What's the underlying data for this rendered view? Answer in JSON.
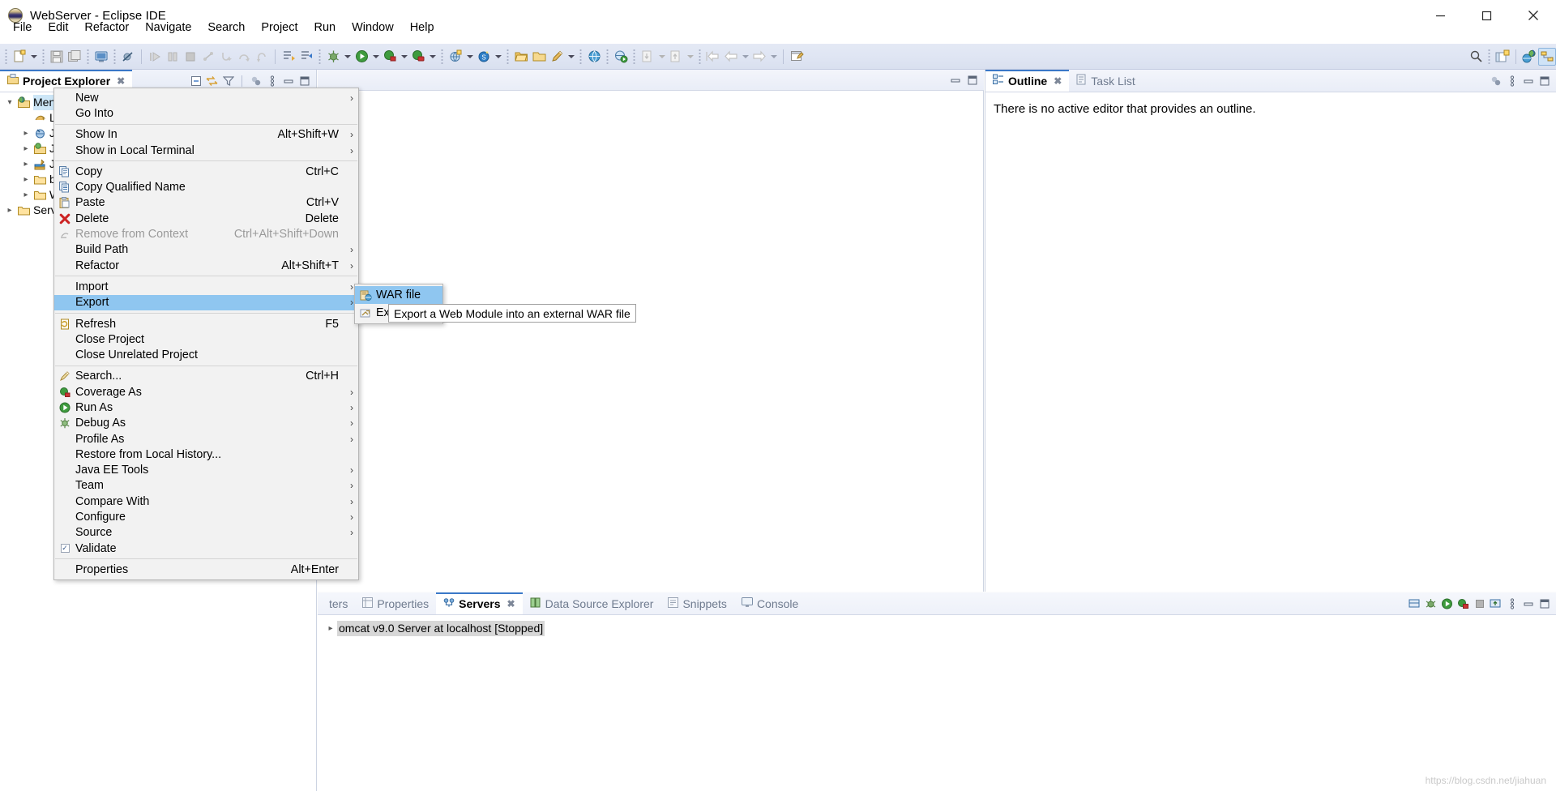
{
  "window": {
    "title": "WebServer - Eclipse IDE",
    "app_icon": "eclipse-icon",
    "minimize_label": "Minimize",
    "maximize_label": "Maximize",
    "close_label": "Close"
  },
  "menubar": {
    "items": [
      {
        "label": "File"
      },
      {
        "label": "Edit"
      },
      {
        "label": "Refactor"
      },
      {
        "label": "Navigate"
      },
      {
        "label": "Search"
      },
      {
        "label": "Project"
      },
      {
        "label": "Run"
      },
      {
        "label": "Window"
      },
      {
        "label": "Help"
      }
    ]
  },
  "toolbar": {
    "groups": [
      {
        "items": [
          {
            "icon": "new-wizard-icon",
            "dropdown": true,
            "enabled": true
          },
          {
            "icon": "save-icon",
            "dropdown": false,
            "enabled": false
          },
          {
            "icon": "save-all-icon",
            "dropdown": false,
            "enabled": false
          }
        ]
      },
      {
        "items": [
          {
            "icon": "new-console-icon",
            "dropdown": false,
            "enabled": true
          }
        ]
      },
      {
        "items": [
          {
            "icon": "skip-breakpoints-icon",
            "dropdown": false,
            "enabled": true
          }
        ]
      },
      {
        "items": [
          {
            "icon": "resume-icon",
            "dropdown": false,
            "enabled": false
          },
          {
            "icon": "suspend-icon",
            "dropdown": false,
            "enabled": false
          },
          {
            "icon": "terminate-icon",
            "dropdown": false,
            "enabled": false
          },
          {
            "icon": "disconnect-icon",
            "dropdown": false,
            "enabled": false
          },
          {
            "icon": "step-into-icon",
            "dropdown": false,
            "enabled": false
          },
          {
            "icon": "step-over-icon",
            "dropdown": false,
            "enabled": false
          },
          {
            "icon": "step-return-icon",
            "dropdown": false,
            "enabled": false
          }
        ]
      },
      {
        "items": [
          {
            "icon": "next-annotation-icon",
            "dropdown": false,
            "enabled": true
          },
          {
            "icon": "previous-annotation-icon",
            "dropdown": false,
            "enabled": true
          }
        ]
      },
      {
        "items": [
          {
            "icon": "debug-icon",
            "dropdown": true,
            "enabled": true
          },
          {
            "icon": "run-icon",
            "dropdown": true,
            "enabled": true
          },
          {
            "icon": "coverage-icon",
            "dropdown": true,
            "enabled": true
          },
          {
            "icon": "profile-icon",
            "dropdown": true,
            "enabled": true
          }
        ]
      },
      {
        "items": [
          {
            "icon": "new-server-icon",
            "dropdown": true,
            "enabled": true
          },
          {
            "icon": "new-dynamic-web-project-icon",
            "dropdown": true,
            "enabled": true
          }
        ]
      },
      {
        "items": [
          {
            "icon": "open-type-icon",
            "dropdown": false,
            "enabled": true
          },
          {
            "icon": "open-task-icon",
            "dropdown": false,
            "enabled": true
          },
          {
            "icon": "new-java-class-icon",
            "dropdown": true,
            "enabled": true
          }
        ]
      },
      {
        "items": [
          {
            "icon": "open-web-browser-icon",
            "dropdown": false,
            "enabled": true
          }
        ]
      },
      {
        "items": [
          {
            "icon": "run-on-server-icon",
            "dropdown": false,
            "enabled": true
          }
        ]
      },
      {
        "items": [
          {
            "icon": "import-icon",
            "dropdown": true,
            "enabled": false
          },
          {
            "icon": "export-icon",
            "dropdown": true,
            "enabled": false
          }
        ]
      },
      {
        "items": [
          {
            "icon": "back-to-icon",
            "dropdown": false,
            "enabled": false
          },
          {
            "icon": "previous-edit-icon",
            "dropdown": true,
            "enabled": false
          },
          {
            "icon": "next-edit-icon",
            "dropdown": true,
            "enabled": false
          }
        ]
      },
      {
        "items": [
          {
            "icon": "new-editor-icon",
            "dropdown": false,
            "enabled": true
          }
        ]
      }
    ],
    "right_items": [
      {
        "icon": "search-icon"
      },
      {
        "icon": "open-perspective-icon"
      },
      {
        "icon": "java-ee-perspective-icon"
      },
      {
        "icon": "java-perspective-icon"
      }
    ]
  },
  "explorer": {
    "tab_label": "Project Explorer",
    "tab_icon": "project-explorer-icon",
    "close_glyph": "✖",
    "tools": [
      {
        "icon": "collapse-all-icon"
      },
      {
        "icon": "link-with-editor-icon"
      },
      {
        "icon": "view-menu-filter-icon"
      },
      {
        "icon": "focus-on-active-task-icon"
      },
      {
        "icon": "view-menu-icon"
      },
      {
        "icon": "minimize-icon"
      },
      {
        "icon": "maximize-icon"
      }
    ],
    "tree": [
      {
        "label": "MengYangChen",
        "icon": "dynamic-web-project-icon",
        "twisty": "v",
        "indent": 0,
        "selected": true
      },
      {
        "label": "Lo",
        "icon": "deployment-descriptor-icon",
        "twisty": "",
        "indent": 1,
        "selected": false
      },
      {
        "label": "JA",
        "icon": "jax-ws-icon",
        "twisty": ">",
        "indent": 1,
        "selected": false
      },
      {
        "label": "Ja",
        "icon": "java-resources-icon",
        "twisty": ">",
        "indent": 1,
        "selected": false
      },
      {
        "label": "Ja",
        "icon": "javascript-resources-icon",
        "twisty": ">",
        "indent": 1,
        "selected": false
      },
      {
        "label": "bu",
        "icon": "folder-icon",
        "twisty": ">",
        "indent": 1,
        "selected": false
      },
      {
        "label": "W",
        "icon": "folder-icon",
        "twisty": ">",
        "indent": 1,
        "selected": false
      },
      {
        "label": "Serv",
        "icon": "servers-folder-icon",
        "twisty": ">",
        "indent": 0,
        "selected": false
      }
    ]
  },
  "editor": {
    "tools": [
      {
        "icon": "restore-icon"
      },
      {
        "icon": "maximize-icon"
      }
    ]
  },
  "outline": {
    "tabs": [
      {
        "label": "Outline",
        "icon": "outline-icon",
        "active": true,
        "closeable": true
      },
      {
        "label": "Task List",
        "icon": "task-list-icon",
        "active": false,
        "closeable": false
      }
    ],
    "close_glyph": "✖",
    "tools": [
      {
        "icon": "focus-on-active-task-icon"
      },
      {
        "icon": "view-menu-icon"
      },
      {
        "icon": "minimize-icon"
      },
      {
        "icon": "maximize-icon"
      }
    ],
    "message": "There is no active editor that provides an outline."
  },
  "bottom_panel": {
    "tabs": [
      {
        "label": "ters",
        "icon": "markers-icon",
        "active": false,
        "closeable": false
      },
      {
        "label": "Properties",
        "icon": "properties-icon",
        "active": false,
        "closeable": false
      },
      {
        "label": "Servers",
        "icon": "servers-icon",
        "active": true,
        "closeable": true
      },
      {
        "label": "Data Source Explorer",
        "icon": "data-source-explorer-icon",
        "active": false,
        "closeable": false
      },
      {
        "label": "Snippets",
        "icon": "snippets-icon",
        "active": false,
        "closeable": false
      },
      {
        "label": "Console",
        "icon": "console-icon",
        "active": false,
        "closeable": false
      }
    ],
    "close_glyph": "✖",
    "tools": [
      {
        "icon": "start-server-icon"
      },
      {
        "icon": "debug-server-icon"
      },
      {
        "icon": "start-icon"
      },
      {
        "icon": "profile-server-icon"
      },
      {
        "icon": "stop-icon"
      },
      {
        "icon": "publish-icon"
      },
      {
        "icon": "view-menu-icon"
      },
      {
        "icon": "minimize-icon"
      },
      {
        "icon": "maximize-icon"
      }
    ],
    "servers": [
      {
        "twisty": ">",
        "label": "omcat v9.0 Server at localhost  [Stopped]"
      }
    ]
  },
  "context_menu": {
    "items": [
      {
        "label": "New",
        "accel": "",
        "submenu": true,
        "icon": "",
        "enabled": true,
        "highlight": false
      },
      {
        "label": "Go Into",
        "accel": "",
        "submenu": false,
        "icon": "",
        "enabled": true,
        "highlight": false
      },
      {
        "separator": true
      },
      {
        "label": "Show In",
        "accel": "Alt+Shift+W",
        "submenu": true,
        "icon": "",
        "enabled": true,
        "highlight": false
      },
      {
        "label": "Show in Local Terminal",
        "accel": "",
        "submenu": true,
        "icon": "",
        "enabled": true,
        "highlight": false
      },
      {
        "separator": true
      },
      {
        "label": "Copy",
        "accel": "Ctrl+C",
        "submenu": false,
        "icon": "copy-icon",
        "enabled": true,
        "highlight": false
      },
      {
        "label": "Copy Qualified Name",
        "accel": "",
        "submenu": false,
        "icon": "copy-qualified-name-icon",
        "enabled": true,
        "highlight": false
      },
      {
        "label": "Paste",
        "accel": "Ctrl+V",
        "submenu": false,
        "icon": "paste-icon",
        "enabled": true,
        "highlight": false
      },
      {
        "label": "Delete",
        "accel": "Delete",
        "submenu": false,
        "icon": "delete-icon",
        "enabled": true,
        "highlight": false
      },
      {
        "label": "Remove from Context",
        "accel": "Ctrl+Alt+Shift+Down",
        "submenu": false,
        "icon": "remove-from-context-icon",
        "enabled": false,
        "highlight": false
      },
      {
        "label": "Build Path",
        "accel": "",
        "submenu": true,
        "icon": "",
        "enabled": true,
        "highlight": false
      },
      {
        "label": "Refactor",
        "accel": "Alt+Shift+T",
        "submenu": true,
        "icon": "",
        "enabled": true,
        "highlight": false
      },
      {
        "separator": true
      },
      {
        "label": "Import",
        "accel": "",
        "submenu": true,
        "icon": "",
        "enabled": true,
        "highlight": false
      },
      {
        "label": "Export",
        "accel": "",
        "submenu": true,
        "icon": "",
        "enabled": true,
        "highlight": true
      },
      {
        "separator": true
      },
      {
        "label": "Refresh",
        "accel": "F5",
        "submenu": false,
        "icon": "refresh-icon",
        "enabled": true,
        "highlight": false
      },
      {
        "label": "Close Project",
        "accel": "",
        "submenu": false,
        "icon": "",
        "enabled": true,
        "highlight": false
      },
      {
        "label": "Close Unrelated Project",
        "accel": "",
        "submenu": false,
        "icon": "",
        "enabled": true,
        "highlight": false
      },
      {
        "separator": true
      },
      {
        "label": "Search...",
        "accel": "Ctrl+H",
        "submenu": false,
        "icon": "search-menu-icon",
        "enabled": true,
        "highlight": false
      },
      {
        "label": "Coverage As",
        "accel": "",
        "submenu": true,
        "icon": "coverage-icon",
        "enabled": true,
        "highlight": false
      },
      {
        "label": "Run As",
        "accel": "",
        "submenu": true,
        "icon": "run-icon",
        "enabled": true,
        "highlight": false
      },
      {
        "label": "Debug As",
        "accel": "",
        "submenu": true,
        "icon": "debug-icon",
        "enabled": true,
        "highlight": false
      },
      {
        "label": "Profile As",
        "accel": "",
        "submenu": true,
        "icon": "",
        "enabled": true,
        "highlight": false
      },
      {
        "label": "Restore from Local History...",
        "accel": "",
        "submenu": false,
        "icon": "",
        "enabled": true,
        "highlight": false
      },
      {
        "label": "Java EE Tools",
        "accel": "",
        "submenu": true,
        "icon": "",
        "enabled": true,
        "highlight": false
      },
      {
        "label": "Team",
        "accel": "",
        "submenu": true,
        "icon": "",
        "enabled": true,
        "highlight": false
      },
      {
        "label": "Compare With",
        "accel": "",
        "submenu": true,
        "icon": "",
        "enabled": true,
        "highlight": false
      },
      {
        "label": "Configure",
        "accel": "",
        "submenu": true,
        "icon": "",
        "enabled": true,
        "highlight": false
      },
      {
        "label": "Source",
        "accel": "",
        "submenu": true,
        "icon": "",
        "enabled": true,
        "highlight": false
      },
      {
        "label": "Validate",
        "accel": "",
        "submenu": false,
        "icon": "checkbox-checked-icon",
        "enabled": true,
        "highlight": false
      },
      {
        "separator": true
      },
      {
        "label": "Properties",
        "accel": "Alt+Enter",
        "submenu": false,
        "icon": "",
        "enabled": true,
        "highlight": false
      }
    ],
    "submenu_arrow": "›"
  },
  "export_submenu": {
    "items": [
      {
        "label": "WAR file",
        "icon": "war-file-icon",
        "highlight": true
      },
      {
        "label": "Ex",
        "icon": "ear-file-icon",
        "highlight": false
      }
    ]
  },
  "tooltip": {
    "text": "Export a Web Module into an external WAR file"
  },
  "watermark": {
    "text": "https://blog.csdn.net/jiahuan"
  },
  "colors": {
    "menu_highlight": "#8fc6f0",
    "tree_selection": "#cde6f7",
    "toolbar_bg": "#dfe5f3",
    "active_tab_underline": "#3a78c8",
    "inactive_tab_text": "#6f7b8f"
  }
}
